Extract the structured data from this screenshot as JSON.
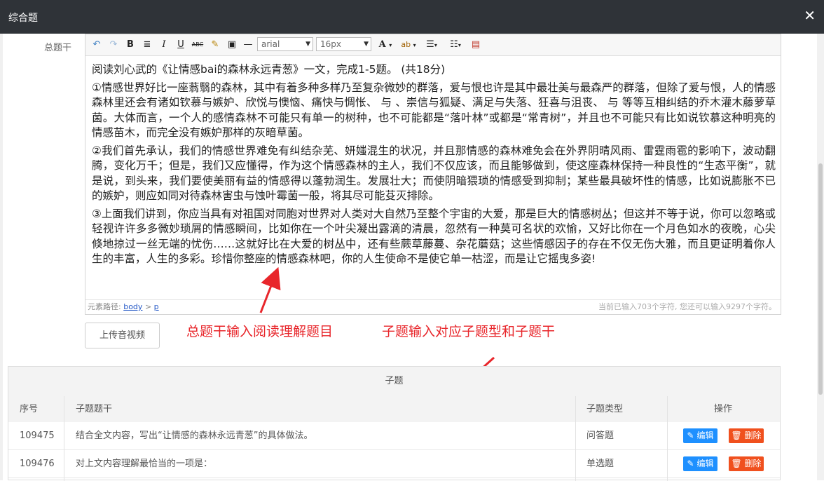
{
  "dialog": {
    "title": "综合题",
    "close_glyph": "✕"
  },
  "form": {
    "stem_label": "总题干",
    "upload_label": "上传音视频"
  },
  "toolbar": {
    "bold": "B",
    "italic": "I",
    "underline": "U",
    "strike": "ABC",
    "font_family": "arial",
    "font_size": "16px"
  },
  "editor": {
    "paragraphs": [
      "阅读刘心武的《让情感bai的森林永远青葱》一文，完成1-5题。 (共18分)",
      "①情感世界好比一座蓊翳的森林，其中有着多种多样乃至复杂微妙的群落，爱与恨也许是其中最壮美与最森严的群落，但除了爱与恨，人的情感森林里还会有诸如钦慕与嫉妒、欣悦与懊恼、痛快与惆怅、 与 、崇信与狐疑、满足与失落、狂喜与沮丧、 与 等等互相纠结的乔木灌木藤萝草菌。大体而言，一个人的感情森林不可能只有单一的树种，也不可能都是“落叶林”或都是“常青树”，并且也不可能只有比如说钦慕这种明亮的情感苗木，而完全没有嫉妒那样的灰暗草菌。",
      "②我们首先承认，我们的情感世界难免有纠结杂芜、妍媸混生的状况，并且那情感的森林难免会在外界阴晴风雨、雷霆雨雹的影响下，波动翻腾，变化万千；但是，我们又应懂得，作为这个情感森林的主人，我们不仅应该，而且能够做到，使这座森林保持一种良性的“生态平衡”，就是说，到头来，我们要使美丽有益的情感得以蓬勃润生。发展壮大；而使阴暗猥琐的情感受到抑制；某些最具破坏性的情感，比如说膨胀不已的嫉妒，则应如同对待森林害虫与蚀叶霉菌一般，将其尽可能芟灭排除。",
      "③上面我们讲到，你应当具有对祖国对同胞对世界对人类对大自然乃至整个宇宙的大爱，那是巨大的情感树丛；但这并不等于说，你可以忽略或轻视许许多多微妙琐屑的情感瞬间，比如你在一个叶尖凝出露滴的清晨，忽然有一种莫可名状的欢愉，又好比你在一个月色如水的夜晚，心尖倏地掠过一丝无端的忧伤……这就好比在大爱的树丛中，还有些蕨草藤蔓、杂花蘑菇；这些情感因子的存在不仅无伤大雅，而且更证明着你人生的丰富，人生的多彩。珍惜你整座的情感森林吧，你的人生使命不是使它单一枯涩，而是让它摇曳多姿!"
    ],
    "status_path_label": "元素路径:",
    "status_path_body": "body",
    "status_path_sep": ">",
    "status_path_p": "p",
    "char_count": "当前已输入703个字符, 您还可以输入9297个字符。"
  },
  "annotations": {
    "left": "总题干输入阅读理解题目",
    "right": "子题输入对应子题型和子题干",
    "color": "#e8262b"
  },
  "subtable": {
    "title": "子题",
    "headers": {
      "id": "序号",
      "stem": "子题题干",
      "type": "子题类型",
      "ops": "操作"
    },
    "rows": [
      {
        "id": "109475",
        "stem": "结合全文内容，写出“让情感的森林永远青葱”的具体做法。",
        "type": "问答题",
        "edit": "编辑",
        "del": "删除"
      },
      {
        "id": "109476",
        "stem": "对上文内容理解最恰当的一项是：",
        "type": "单选题",
        "edit": "编辑",
        "del": "删除"
      }
    ]
  }
}
